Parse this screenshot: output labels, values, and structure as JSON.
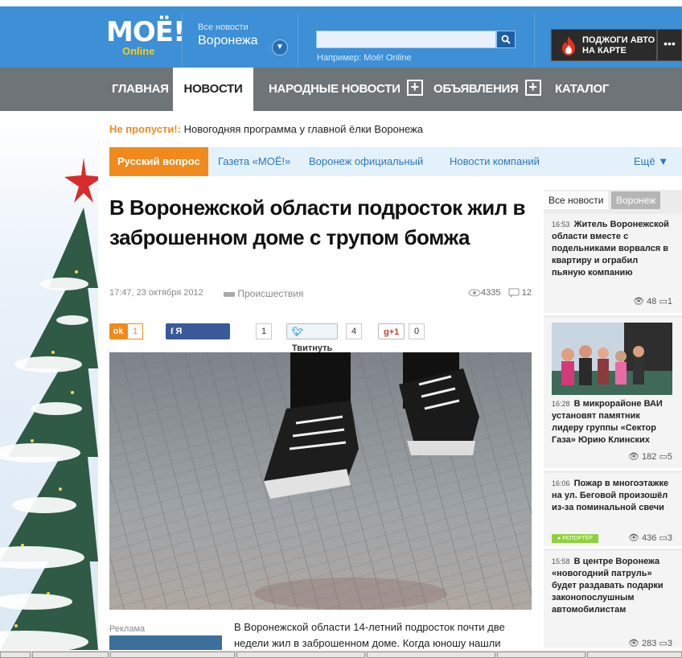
{
  "header": {
    "logo_main": "МОЁ!",
    "logo_sub": "Online",
    "city_small": "Все новости",
    "city_big": "Воронежа",
    "search_value": "",
    "search_hint": "Например: Моё! Online",
    "promo_line1": "ПОДЖОГИ АВТО",
    "promo_line2": "НА КАРТЕ",
    "more": "•••"
  },
  "nav": [
    "ГЛАВНАЯ",
    "НОВОСТИ",
    "НАРОДНЫЕ НОВОСТИ",
    "ОБЪЯВЛЕНИЯ",
    "КАТАЛОГ ОРГАНИЗАЦИЙ"
  ],
  "dont_miss": {
    "label": "Не пропусти!:",
    "text": "Новогодняя программа у главной ёлки Воронежа"
  },
  "rubrics": {
    "items": [
      "Русский вопрос",
      "Газета «МОЁ!»",
      "Воронеж официальный",
      "Новости компаний"
    ],
    "more": "Ещё ▼"
  },
  "article": {
    "title": "В Воронежской области подросток жил в заброшенном доме с трупом бомжа",
    "datetime": "17:47, 23 октября 2012",
    "category": "Происшествия",
    "views": "4335",
    "comments": "12",
    "lead": "В Воронежской области 14-летний подросток почти две недели жил в заброшенном доме. Когда юношу нашли"
  },
  "social": {
    "ok_count": "1",
    "fb_label": "Я рекомендую",
    "fb_count": "1",
    "tw_label": "Твитнуть",
    "tw_count": "4",
    "gp_label": "+1",
    "gp_count": "0"
  },
  "ad_label": "Реклама",
  "sidebar": {
    "tab_all": "Все новости",
    "tab_city": "Воронеж",
    "news": [
      {
        "time": "16:53",
        "text": "Житель Воронежской области вместе с подельниками ворвался в квартиру и ограбил пьяную компанию",
        "views": "48",
        "comments": "1"
      },
      {
        "time": "16:28",
        "text": "В микрорайоне ВАИ установят памятник лидеру группы «Сектор Газа» Юрию Клинских",
        "views": "182",
        "comments": "5"
      },
      {
        "time": "16:06",
        "text": "Пожар в многоэтажке на ул. Беговой произошёл из-за поминальной свечи",
        "views": "436",
        "comments": "3",
        "badge": "● РЕПОРТЁР"
      },
      {
        "time": "15:58",
        "text": "В центре Воронежа «новогодний патруль» будет раздавать подарки законопослушным автомобилистам",
        "views": "283",
        "comments": "3"
      }
    ]
  },
  "colors": {
    "header_blue": "#3d8fd6",
    "nav_gray": "#6f7479",
    "accent_orange": "#f08a1c",
    "link_blue": "#2b78c2"
  }
}
